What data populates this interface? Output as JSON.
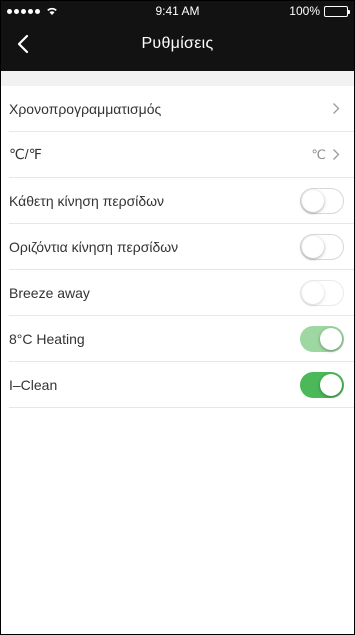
{
  "status_bar": {
    "time": "9:41 AM",
    "battery": "100%"
  },
  "nav": {
    "title": "Ρυθμίσεις"
  },
  "rows": [
    {
      "label": "Χρονοπρογραμματισμός",
      "value": "",
      "type": "chevron"
    },
    {
      "label": "℃/℉",
      "value": "℃",
      "type": "chevron"
    },
    {
      "label": "Κάθετη κίνηση περσίδων",
      "type": "toggle",
      "state": "off"
    },
    {
      "label": "Οριζόντια κίνηση περσίδων",
      "type": "toggle",
      "state": "off"
    },
    {
      "label": "Breeze away",
      "type": "toggle",
      "state": "off-disabled"
    },
    {
      "label": "8°C Heating",
      "type": "toggle",
      "state": "on-disabled"
    },
    {
      "label": "I–Clean",
      "type": "toggle",
      "state": "on"
    }
  ],
  "colors": {
    "header": "#121212",
    "toggle_on": "#4bb85a",
    "toggle_on_disabled": "#9ed7a2"
  }
}
